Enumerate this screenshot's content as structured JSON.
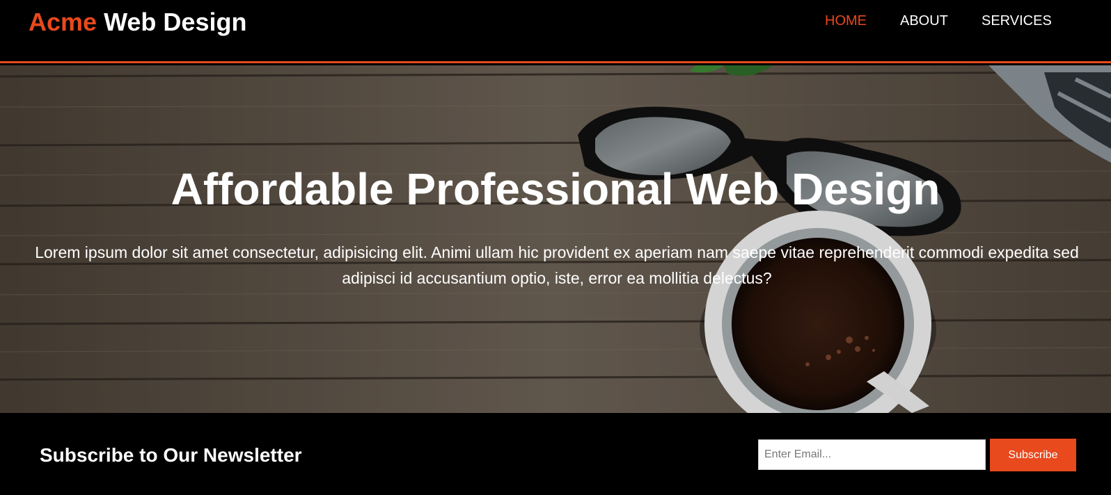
{
  "header": {
    "brand": {
      "highlight": "Acme",
      "rest": "Web Design"
    },
    "nav": [
      {
        "label": "HOME",
        "active": true
      },
      {
        "label": "ABOUT",
        "active": false
      },
      {
        "label": "SERVICES",
        "active": false
      }
    ]
  },
  "showcase": {
    "title": "Affordable Professional Web Design",
    "text": "Lorem ipsum dolor sit amet consectetur, adipisicing elit. Animi ullam hic provident ex aperiam nam saepe vitae reprehenderit commodi expedita sed adipisci id accusantium optio, iste, error ea mollitia delectus?"
  },
  "newsletter": {
    "title": "Subscribe to Our Newsletter",
    "email_placeholder": "Enter Email...",
    "email_value": "",
    "button_label": "Subscribe"
  },
  "colors": {
    "accent": "#e8491d",
    "header_bg": "#000000",
    "text_light": "#ffffff"
  }
}
